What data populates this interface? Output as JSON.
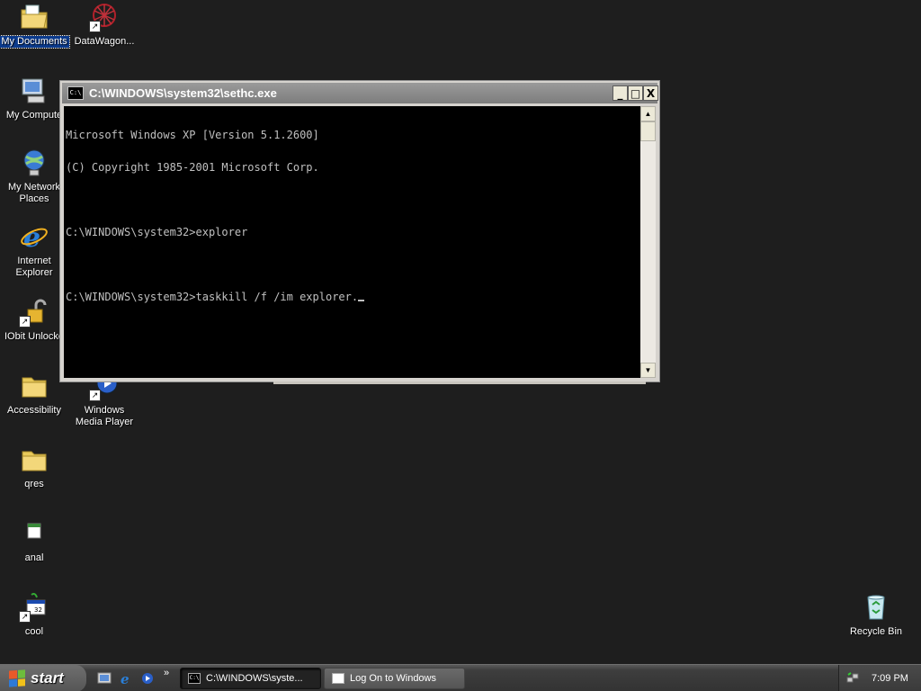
{
  "desktop": {
    "icons": [
      {
        "label": "My Documents"
      },
      {
        "label": "DataWagon..."
      },
      {
        "label": "My Compute"
      },
      {
        "label": "My Network Places"
      },
      {
        "label": "Internet Explorer"
      },
      {
        "label": "IObit Unlocke"
      },
      {
        "label": "Accessibility"
      },
      {
        "label": "Windows Media Player"
      },
      {
        "label": "qres"
      },
      {
        "label": "anal"
      },
      {
        "label": "cool"
      },
      {
        "label": "Recycle Bin"
      }
    ]
  },
  "console": {
    "title": "C:\\WINDOWS\\system32\\sethc.exe",
    "icon_text": "C:\\",
    "lines": [
      "Microsoft Windows XP [Version 5.1.2600]",
      "(C) Copyright 1985-2001 Microsoft Corp.",
      "C:\\WINDOWS\\system32>explorer",
      "C:\\WINDOWS\\system32>taskkill /f /im explorer."
    ],
    "minimize_glyph": "_",
    "maximize_glyph": "□",
    "close_glyph": "X",
    "scroll_up_glyph": "▲",
    "scroll_down_glyph": "▼"
  },
  "taskbar": {
    "start_label": "start",
    "quick_launch_chevron": "»",
    "tasks": [
      {
        "label": "C:\\WINDOWS\\syste...",
        "icon_text": "C:\\"
      },
      {
        "label": "Log On to Windows"
      }
    ],
    "clock": "7:09 PM"
  },
  "colors": {
    "desktop_bg": "#1e1e1e",
    "console_bg": "#000000",
    "console_text": "#c0c0c0",
    "titlebar": "#8a8a8a"
  }
}
